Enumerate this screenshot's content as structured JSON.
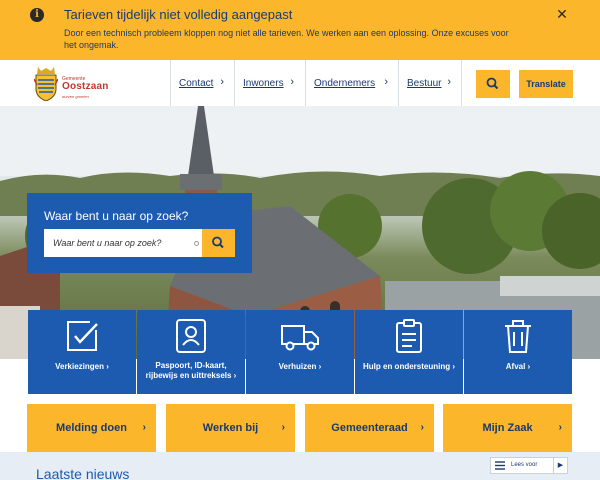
{
  "alert": {
    "title": "Tarieven tijdelijk niet volledig aangepast",
    "message": "Door een technisch probleem kloppen nog niet alle tarieven. We werken aan een oplossing. Onze excuses voor het ongemak.",
    "info_icon": "info-icon",
    "close_icon": "close-icon"
  },
  "header": {
    "logo": {
      "small": "Gemeente",
      "name": "Oostzaan",
      "tagline": "durven groeien"
    },
    "nav": [
      {
        "label": "Contact"
      },
      {
        "label": "Inwoners"
      },
      {
        "label": "Ondernemers"
      },
      {
        "label": "Bestuur"
      }
    ],
    "search_icon": "search-icon",
    "translate_label": "Translate"
  },
  "search": {
    "title": "Waar bent u naar op zoek?",
    "placeholder": "Waar bent u naar op zoek?"
  },
  "tiles": [
    {
      "label": "Verkiezingen",
      "icon": "ballot-check-icon"
    },
    {
      "label": "Paspoort, ID-kaart, rijbewijs en uittreksels",
      "icon": "id-card-icon"
    },
    {
      "label": "Verhuizen",
      "icon": "truck-icon"
    },
    {
      "label": "Hulp en ondersteuning",
      "icon": "clipboard-icon"
    },
    {
      "label": "Afval",
      "icon": "trash-bin-icon"
    }
  ],
  "quicklinks": [
    {
      "label": "Melding doen"
    },
    {
      "label": "Werken bij"
    },
    {
      "label": "Gemeenteraad"
    },
    {
      "label": "Mijn Zaak"
    }
  ],
  "news_heading": "Laatste nieuws",
  "readspeaker": {
    "label": "Lees voor"
  },
  "colors": {
    "brand_blue": "#1d5bb0",
    "accent_yellow": "#fbb62b",
    "navy_text": "#1a3a6e"
  }
}
